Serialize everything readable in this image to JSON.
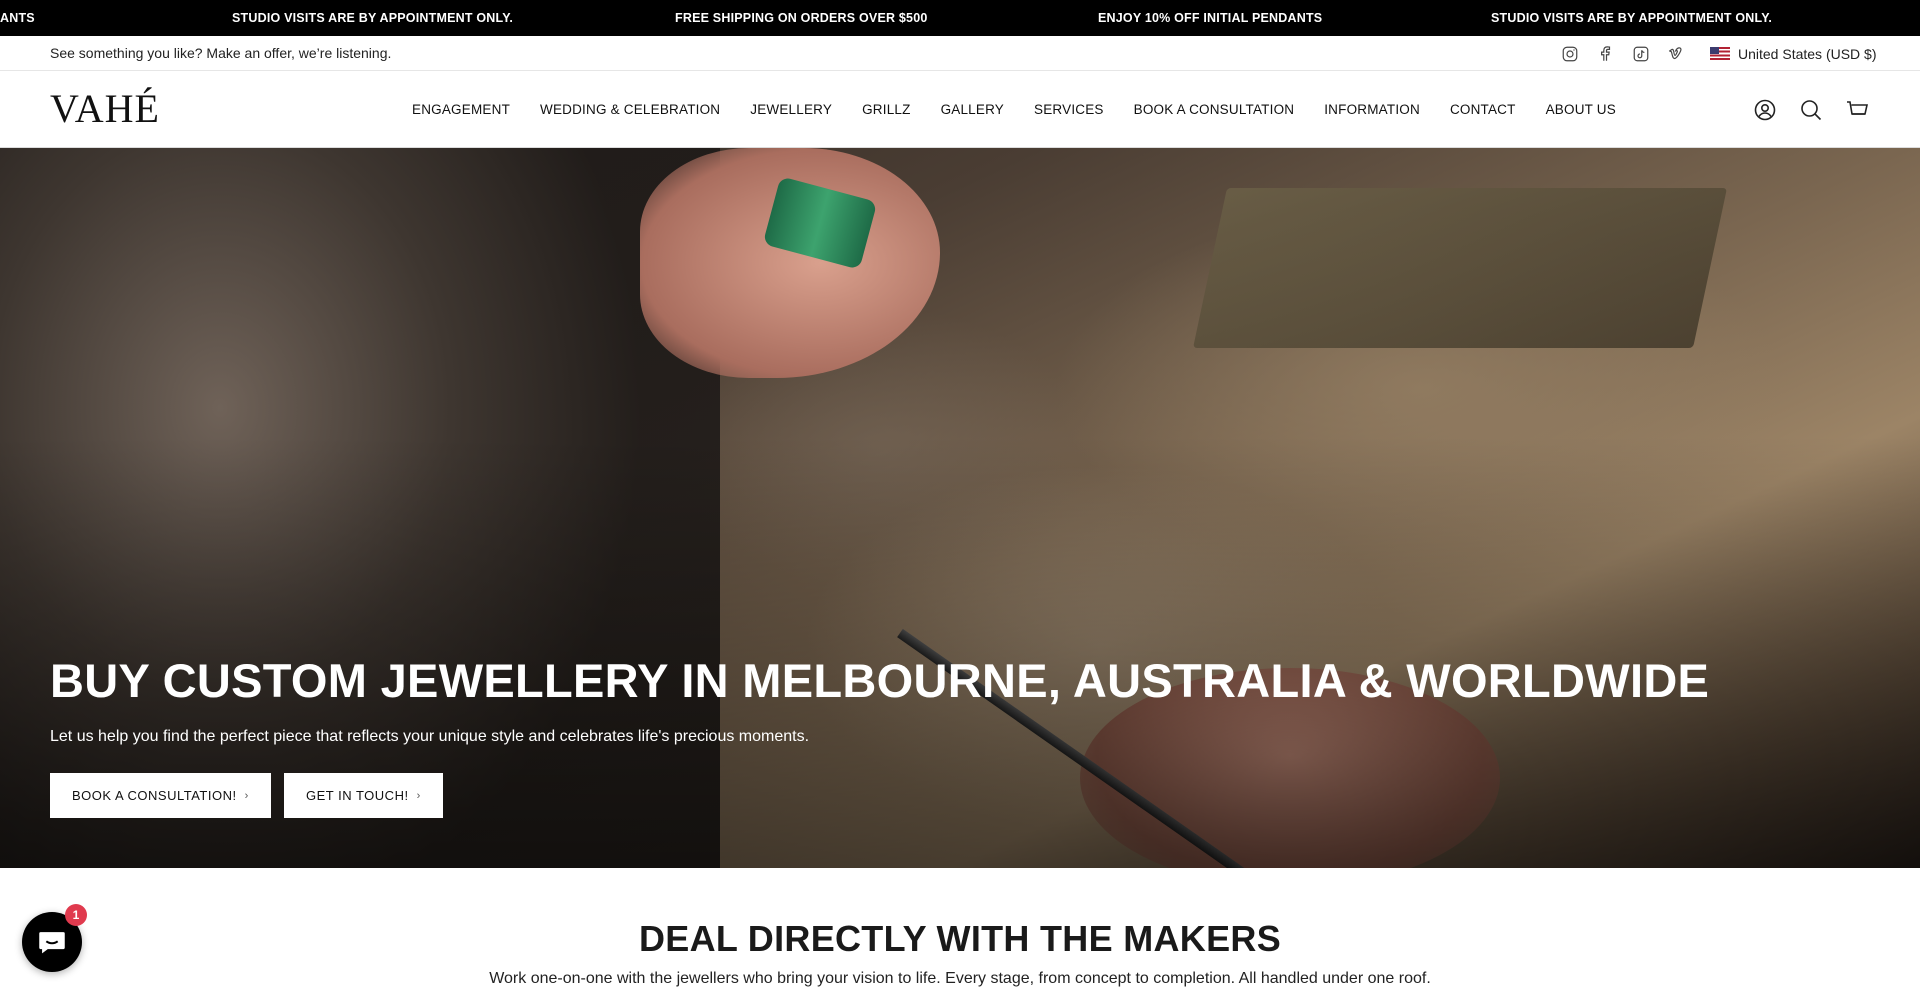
{
  "announcements": [
    "ANTS",
    "STUDIO VISITS ARE BY APPOINTMENT ONLY.",
    "FREE SHIPPING ON ORDERS OVER $500",
    "ENJOY 10% OFF INITIAL PENDANTS",
    "STUDIO VISITS ARE BY APPOINTMENT ONLY."
  ],
  "utility": {
    "offer_text": "See something you like? Make an offer, we’re listening.",
    "social": [
      "instagram-icon",
      "facebook-icon",
      "tiktok-icon",
      "vimeo-icon"
    ],
    "locale": "United States (USD $)"
  },
  "header": {
    "logo": "VAHÉ",
    "nav": [
      "ENGAGEMENT",
      "WEDDING & CELEBRATION",
      "JEWELLERY",
      "GRILLZ",
      "GALLERY",
      "SERVICES",
      "BOOK A CONSULTATION",
      "INFORMATION",
      "CONTACT",
      "ABOUT US"
    ],
    "icons": [
      "account-icon",
      "search-icon",
      "cart-icon"
    ]
  },
  "hero": {
    "title": "BUY CUSTOM JEWELLERY IN MELBOURNE, AUSTRALIA & WORLDWIDE",
    "subtitle": "Let us help you find the perfect piece that reflects your unique style and celebrates life's precious moments.",
    "buttons": [
      "BOOK A CONSULTATION!",
      "GET IN TOUCH!"
    ]
  },
  "makers": {
    "title": "DEAL DIRECTLY WITH THE MAKERS",
    "subtitle": "Work one-on-one with the jewellers who bring your vision to life. Every stage, from concept to completion. All handled under one roof."
  },
  "chat": {
    "badge": "1"
  }
}
